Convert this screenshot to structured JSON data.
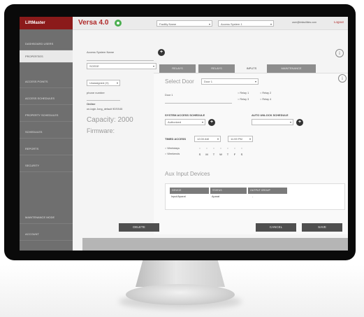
{
  "header": {
    "logo": "LiftMaster",
    "app_title": "Versa 4.0",
    "facility_select": "Facility Name",
    "access_system_select": "Access System 1",
    "user_email": "user@lmfacilities.com",
    "logout": "Logout"
  },
  "sidebar": {
    "items": [
      {
        "label": "Dashboard Users"
      },
      {
        "label": "Properties"
      },
      {
        "label": "Access Points"
      },
      {
        "label": "Access Schedules"
      },
      {
        "label": "Property Schedules"
      },
      {
        "label": "Schedules"
      },
      {
        "label": "Reports"
      },
      {
        "label": "Security"
      },
      {
        "label": "Maintenance Mode"
      },
      {
        "label": "Account"
      }
    ]
  },
  "form": {
    "access_system_name_label": "Access System Name",
    "access_system_name_value": "",
    "system_select": "SCEDE",
    "location_select": "Unassigned (X)",
    "phone_label": "phone number",
    "status_label": "Online",
    "status_detail": "on-logix Jong_default 9DSS45",
    "capacity": "Capacity: 2000",
    "firmware": "Firmware:"
  },
  "tabs": [
    {
      "label": "Relays"
    },
    {
      "label": "Relays"
    },
    {
      "label": "Inputs"
    },
    {
      "label": "Maintenance"
    }
  ],
  "panel": {
    "select_door_label": "Select Door",
    "door_select": "Door 1",
    "door_name": "Door 1",
    "relays": [
      "Relay 1",
      "Relay 2",
      "Relay 3",
      "Relay 4"
    ],
    "system_access_schedule_head": "System Access Schedule",
    "system_access_schedule_value": "Authorized",
    "auto_unlock_schedule_head": "Auto Unlock Schedule",
    "auto_unlock_schedule_value": "",
    "timed_access_label": "Timed Access",
    "time_from": "12:00 AM",
    "time_to": "11:59 PM",
    "weekdays_label": "Weekdays",
    "weekends_label": "Weekends",
    "day_letters": [
      "S",
      "M",
      "T",
      "W",
      "T",
      "F",
      "S"
    ],
    "aux_title": "Aux Input Devices",
    "aux_columns": [
      "Device",
      "Status",
      "Output Group"
    ],
    "aux_rows": [
      {
        "device": "Input/Aparat",
        "status": "Aparat",
        "group": "-"
      }
    ]
  },
  "buttons": {
    "delete": "Delete",
    "cancel": "Cancel",
    "save": "Save"
  },
  "colors": {
    "brand": "#8b1a1a",
    "sidebar": "#6f6f6f",
    "status_ok": "#4caf50"
  }
}
